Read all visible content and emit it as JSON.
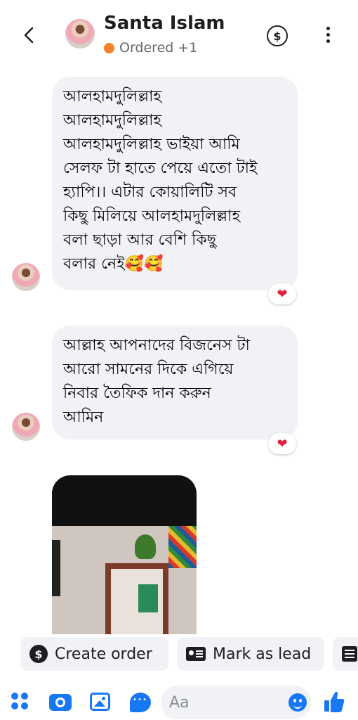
{
  "header": {
    "contact_name": "Santa Islam",
    "status_text": "Ordered +1",
    "status_color": "#f5822a",
    "icons": [
      "back-arrow-icon",
      "dollar-icon",
      "more-vertical-icon"
    ]
  },
  "messages": [
    {
      "lines": [
        "আলহামদুলিল্লাহ",
        "আলহামদুলিল্লাহ",
        "আলহামদুলিল্লাহ ভাইয়া আমি",
        "সেলফ টা হাতে পেয়ে এতো টাই",
        "হ্যাপি।। এটার কোয়ালিটি সব",
        "কিছু মিলিয়ে আলহামদুলিল্লাহ",
        "বলা ছাড়া আর বেশি কিছু",
        "বলার নেই🥰🥰"
      ],
      "reaction": "❤"
    },
    {
      "lines": [
        "আল্লাহ আপনাদের বিজনেস টা",
        "আরো সামনের দিকে এগিয়ে",
        "নিবার তৈফিক দান করুন",
        "আমিন"
      ],
      "reaction": "❤"
    }
  ],
  "quick_actions": {
    "create_order": "Create order",
    "mark_as_lead": "Mark as lead"
  },
  "composer": {
    "placeholder": "Aa",
    "accent_color": "#1877f2"
  }
}
